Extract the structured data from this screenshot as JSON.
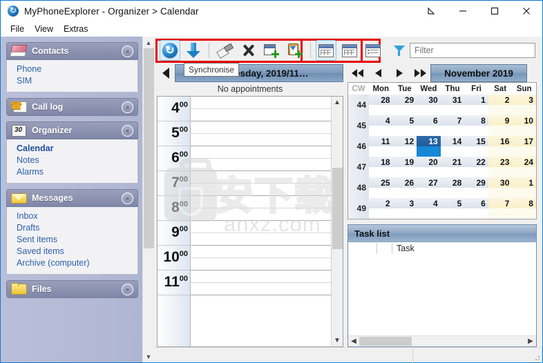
{
  "window": {
    "title": "MyPhoneExplorer - Organizer > Calendar",
    "app_icon": "sync-globe-icon",
    "controls": [
      {
        "name": "restore-size-icon",
        "glyph": "◢"
      },
      {
        "name": "minimize-button",
        "glyph": "─"
      },
      {
        "name": "maximize-button",
        "glyph": "□"
      },
      {
        "name": "close-button",
        "glyph": "✕"
      }
    ]
  },
  "menubar": {
    "items": [
      {
        "label": "File"
      },
      {
        "label": "View"
      },
      {
        "label": "Extras"
      }
    ]
  },
  "sidebar": {
    "groups": [
      {
        "title": "Contacts",
        "icon": "address-book-icon",
        "expanded": true,
        "chevron": "«",
        "items": [
          {
            "label": "Phone",
            "active": false
          },
          {
            "label": "SIM",
            "active": false
          }
        ]
      },
      {
        "title": "Call log",
        "icon": "phone-log-icon",
        "expanded": false,
        "chevron": "»",
        "items": []
      },
      {
        "title": "Organizer",
        "icon": "calendar-organizer-icon",
        "expanded": true,
        "chevron": "«",
        "items": [
          {
            "label": "Calendar",
            "active": true
          },
          {
            "label": "Notes",
            "active": false
          },
          {
            "label": "Alarms",
            "active": false
          }
        ]
      },
      {
        "title": "Messages",
        "icon": "envelope-icon",
        "expanded": true,
        "chevron": "«",
        "items": [
          {
            "label": "Inbox",
            "active": false
          },
          {
            "label": "Drafts",
            "active": false
          },
          {
            "label": "Sent items",
            "active": false
          },
          {
            "label": "Saved items",
            "active": false
          },
          {
            "label": "Archive (computer)",
            "active": false
          }
        ]
      },
      {
        "title": "Files",
        "icon": "folder-icon",
        "expanded": false,
        "chevron": "»",
        "items": []
      }
    ]
  },
  "toolbar": {
    "highlight_color": "#e60000",
    "buttons": [
      {
        "name": "sync-button",
        "icon": "sync-icon",
        "selected": true
      },
      {
        "name": "download-button",
        "icon": "download-arrow-icon",
        "selected": false
      },
      {
        "name": "edit-button",
        "icon": "pencil-edit-icon",
        "selected": false
      },
      {
        "name": "delete-button",
        "icon": "x-delete-icon",
        "selected": false
      },
      {
        "name": "new-appointment-button",
        "icon": "calendar-plus-icon",
        "selected": false
      },
      {
        "name": "new-task-button",
        "icon": "clipboard-plus-icon",
        "selected": false
      },
      {
        "name": "view-day-button",
        "icon": "calendar-view-icon",
        "selected": true
      },
      {
        "name": "view-table-button",
        "icon": "table-view-icon",
        "selected": false
      },
      {
        "name": "view-list-button",
        "icon": "list-view-icon",
        "selected": false
      }
    ],
    "filter": {
      "icon": "funnel-filter-icon",
      "placeholder": "Filter",
      "value": ""
    }
  },
  "tooltip": {
    "text": "Synchronise"
  },
  "day_view": {
    "prev_icon": "triangle-left-icon",
    "next_icon": "triangle-right-icon",
    "date_label": "Wednesday, 2019/11…",
    "appointments_status": "No appointments",
    "hours": [
      {
        "hour": "4",
        "minutes": "00"
      },
      {
        "hour": "5",
        "minutes": "00"
      },
      {
        "hour": "6",
        "minutes": "00"
      },
      {
        "hour": "7",
        "minutes": "00"
      },
      {
        "hour": "8",
        "minutes": "00"
      },
      {
        "hour": "9",
        "minutes": "00"
      },
      {
        "hour": "10",
        "minutes": "00"
      },
      {
        "hour": "11",
        "minutes": "00"
      }
    ],
    "scroll_up_icon": "chevron-up-icon",
    "scroll_down_icon": "chevron-down-icon"
  },
  "month_view": {
    "nav": [
      {
        "name": "prev-year-button",
        "icon": "double-left-icon"
      },
      {
        "name": "prev-month-button",
        "icon": "single-left-icon"
      },
      {
        "name": "next-month-button",
        "icon": "single-right-icon"
      },
      {
        "name": "next-year-button",
        "icon": "double-right-icon"
      }
    ],
    "title": "November 2019",
    "columns": [
      "CW",
      "Mon",
      "Tue",
      "Wed",
      "Thu",
      "Fri",
      "Sat",
      "Sun"
    ],
    "selected_day": 13,
    "selected_border_color": "#c41e1e",
    "weeks": [
      {
        "cw": "44",
        "days": [
          "28",
          "29",
          "30",
          "31",
          "1",
          "2",
          "3"
        ]
      },
      {
        "cw": "45",
        "days": [
          "4",
          "5",
          "6",
          "7",
          "8",
          "9",
          "10"
        ]
      },
      {
        "cw": "46",
        "days": [
          "11",
          "12",
          "13",
          "14",
          "15",
          "16",
          "17"
        ]
      },
      {
        "cw": "47",
        "days": [
          "18",
          "19",
          "20",
          "21",
          "22",
          "23",
          "24"
        ]
      },
      {
        "cw": "48",
        "days": [
          "25",
          "26",
          "27",
          "28",
          "29",
          "30",
          "1"
        ]
      },
      {
        "cw": "49",
        "days": [
          "2",
          "3",
          "4",
          "5",
          "6",
          "7",
          "8"
        ]
      }
    ]
  },
  "task_list": {
    "title": "Task list",
    "columns": [
      "",
      "",
      "Task"
    ],
    "rows": [],
    "scroll_left_icon": "chevron-left-icon",
    "scroll_right_icon": "chevron-right-icon"
  },
  "watermark": {
    "text": "anxz.com",
    "cn_text": "安下载"
  },
  "statusbar": {
    "cells": [
      "",
      "",
      ""
    ]
  }
}
